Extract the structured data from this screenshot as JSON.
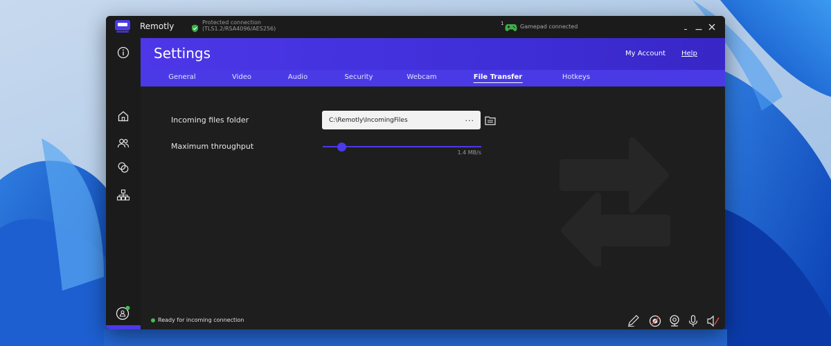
{
  "titlebar": {
    "app_name": "Remotly",
    "security_line1": "Protected connection",
    "security_line2": "(TLS1.2/RSA4096/AES256)",
    "gamepad_count": "1",
    "gamepad_status": "Gamepad connected"
  },
  "banner": {
    "title": "Settings",
    "my_account": "My Account",
    "help": "Help"
  },
  "tabs": [
    {
      "label": "General"
    },
    {
      "label": "Video"
    },
    {
      "label": "Audio"
    },
    {
      "label": "Security"
    },
    {
      "label": "Webcam"
    },
    {
      "label": "File Transfer",
      "active": true
    },
    {
      "label": "Hotkeys"
    }
  ],
  "settings": {
    "incoming_folder_label": "Incoming files folder",
    "incoming_folder_value": "C:\\Remotly\\IncomingFiles",
    "browse_dots": "...",
    "throughput_label": "Maximum throughput",
    "throughput_value": "1.4 MB/s",
    "throughput_level_fraction": 0.12
  },
  "status": {
    "text": "Ready for incoming connection"
  },
  "icons": {
    "accent": "#4b3ae8",
    "status_ok": "#3fbf4f"
  }
}
